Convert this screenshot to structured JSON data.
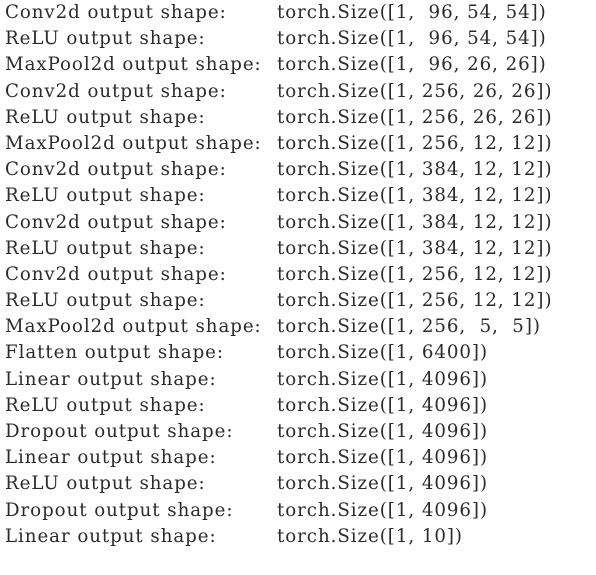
{
  "console": {
    "background_color": "#ffffff",
    "text_color": "#2b2b2b",
    "label_suffix": "output shape:",
    "shape_prefix": "torch.Size",
    "line_count": 21,
    "lines": [
      {
        "layer": "Conv2d",
        "label": "Conv2d output shape:",
        "shape": "torch.Size([1,  96, 54, 54])",
        "dims": [
          1,
          96,
          54,
          54
        ]
      },
      {
        "layer": "ReLU",
        "label": "ReLU output shape:",
        "shape": "torch.Size([1,  96, 54, 54])",
        "dims": [
          1,
          96,
          54,
          54
        ]
      },
      {
        "layer": "MaxPool2d",
        "label": "MaxPool2d output shape:",
        "shape": "torch.Size([1,  96, 26, 26])",
        "dims": [
          1,
          96,
          26,
          26
        ]
      },
      {
        "layer": "Conv2d",
        "label": "Conv2d output shape:",
        "shape": "torch.Size([1, 256, 26, 26])",
        "dims": [
          1,
          256,
          26,
          26
        ]
      },
      {
        "layer": "ReLU",
        "label": "ReLU output shape:",
        "shape": "torch.Size([1, 256, 26, 26])",
        "dims": [
          1,
          256,
          26,
          26
        ]
      },
      {
        "layer": "MaxPool2d",
        "label": "MaxPool2d output shape:",
        "shape": "torch.Size([1, 256, 12, 12])",
        "dims": [
          1,
          256,
          12,
          12
        ]
      },
      {
        "layer": "Conv2d",
        "label": "Conv2d output shape:",
        "shape": "torch.Size([1, 384, 12, 12])",
        "dims": [
          1,
          384,
          12,
          12
        ]
      },
      {
        "layer": "ReLU",
        "label": "ReLU output shape:",
        "shape": "torch.Size([1, 384, 12, 12])",
        "dims": [
          1,
          384,
          12,
          12
        ]
      },
      {
        "layer": "Conv2d",
        "label": "Conv2d output shape:",
        "shape": "torch.Size([1, 384, 12, 12])",
        "dims": [
          1,
          384,
          12,
          12
        ]
      },
      {
        "layer": "ReLU",
        "label": "ReLU output shape:",
        "shape": "torch.Size([1, 384, 12, 12])",
        "dims": [
          1,
          384,
          12,
          12
        ]
      },
      {
        "layer": "Conv2d",
        "label": "Conv2d output shape:",
        "shape": "torch.Size([1, 256, 12, 12])",
        "dims": [
          1,
          256,
          12,
          12
        ]
      },
      {
        "layer": "ReLU",
        "label": "ReLU output shape:",
        "shape": "torch.Size([1, 256, 12, 12])",
        "dims": [
          1,
          256,
          12,
          12
        ]
      },
      {
        "layer": "MaxPool2d",
        "label": "MaxPool2d output shape:",
        "shape": "torch.Size([1, 256,  5,  5])",
        "dims": [
          1,
          256,
          5,
          5
        ]
      },
      {
        "layer": "Flatten",
        "label": "Flatten output shape:",
        "shape": "torch.Size([1, 6400])",
        "dims": [
          1,
          6400
        ]
      },
      {
        "layer": "Linear",
        "label": "Linear output shape:",
        "shape": "torch.Size([1, 4096])",
        "dims": [
          1,
          4096
        ]
      },
      {
        "layer": "ReLU",
        "label": "ReLU output shape:",
        "shape": "torch.Size([1, 4096])",
        "dims": [
          1,
          4096
        ]
      },
      {
        "layer": "Dropout",
        "label": "Dropout output shape:",
        "shape": "torch.Size([1, 4096])",
        "dims": [
          1,
          4096
        ]
      },
      {
        "layer": "Linear",
        "label": "Linear output shape:",
        "shape": "torch.Size([1, 4096])",
        "dims": [
          1,
          4096
        ]
      },
      {
        "layer": "ReLU",
        "label": "ReLU output shape:",
        "shape": "torch.Size([1, 4096])",
        "dims": [
          1,
          4096
        ]
      },
      {
        "layer": "Dropout",
        "label": "Dropout output shape:",
        "shape": "torch.Size([1, 4096])",
        "dims": [
          1,
          4096
        ]
      },
      {
        "layer": "Linear",
        "label": "Linear output shape:",
        "shape": "torch.Size([1, 10])",
        "dims": [
          1,
          10
        ]
      }
    ]
  }
}
